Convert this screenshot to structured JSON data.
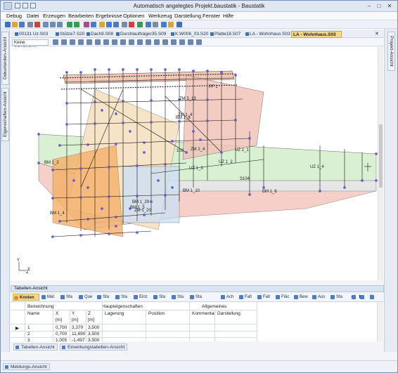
{
  "window": {
    "title": "Automatisch angelegtes Projekt.baustatik - Baustatik",
    "controls": {
      "minimize": "–",
      "maximize": "□",
      "close": "✕"
    }
  },
  "menu": [
    "Debug",
    "Datei",
    "Erzeugen",
    "Bearbeiten",
    "Ergebnisse",
    "Optionen",
    "Werkzeug",
    "Darstellung",
    "Fenster",
    "Hilfe"
  ],
  "side_panels": {
    "left_top": "Dokumenten-Ansicht",
    "left_bottom": "Eigenschaften-Ansicht",
    "right": "Projekt-Ansicht"
  },
  "document_tabs": [
    {
      "label": "00131 Uz.S03",
      "active": false
    },
    {
      "label": "Stütze7.S20",
      "active": false
    },
    {
      "label": "Dach9.S08",
      "active": false
    },
    {
      "label": "Durchlaufträger35.S09",
      "active": false
    },
    {
      "label": "K.W006_03.S20",
      "active": false
    },
    {
      "label": "Platte18.S07",
      "active": false
    },
    {
      "label": "LA - Wohnhaus.S03",
      "active": false
    },
    {
      "label": "LA - Wohnhaus.S03",
      "active": true
    }
  ],
  "view_toolbar": {
    "workplane_select": "Keine Arbeitseben ▾"
  },
  "model_labels": [
    "BM 1_2",
    "BM 1_3",
    "BM 1_4",
    "BM 1_5",
    "BM 1_6",
    "BM 1_10",
    "ZM 1_4",
    "ZM 1_20",
    "UZ 1_1",
    "UZ 1_2",
    "UZ 1_3",
    "UZ 1_4",
    "PF 1",
    "S104",
    "102",
    "ZM 2_4",
    "ZM 3_13",
    "BM 1_29"
  ],
  "axis_labels": {
    "x": "X",
    "y": "Y",
    "z": "Z"
  },
  "table_view": {
    "title": "Tabellen-Ansicht",
    "tools": [
      {
        "label": "Knoten",
        "active": true
      },
      {
        "label": "Mat",
        "active": false
      },
      {
        "label": "Sta",
        "active": false
      },
      {
        "label": "Que",
        "active": false
      },
      {
        "label": "Sta",
        "active": false
      },
      {
        "label": "Sta",
        "active": false
      },
      {
        "label": "Einz",
        "active": false
      },
      {
        "label": "Sta",
        "active": false
      },
      {
        "label": "Sta",
        "active": false
      },
      {
        "label": "Sta",
        "active": false
      },
      {
        "label": "Ach",
        "active": false
      },
      {
        "label": "Falt",
        "active": false
      },
      {
        "label": "Falt",
        "active": false
      },
      {
        "label": "Fläc",
        "active": false
      },
      {
        "label": "Bew",
        "active": false
      },
      {
        "label": "Aus",
        "active": false
      },
      {
        "label": "Sta",
        "active": false
      }
    ],
    "group_headers": {
      "bezeichnung": "Bezeichnung",
      "haupt": "Haupteigenschaften",
      "allgemein": "Allgemeines"
    },
    "columns": [
      "Name",
      "X",
      "Y",
      "Z",
      "Lagerung",
      "Position",
      "Kommentar",
      "Darstellung"
    ],
    "units": [
      "",
      "[m]",
      "[m]",
      "[m]",
      "",
      "",
      "",
      ""
    ],
    "rows": [
      {
        "name": "1",
        "x": "0,700",
        "y": "3,370",
        "z": "3,500"
      },
      {
        "name": "2",
        "x": "0,700",
        "y": "11,890",
        "z": "3,500"
      },
      {
        "name": "3",
        "x": "1,005",
        "y": "-1,497",
        "z": "3,500"
      }
    ],
    "bottom_tabs": [
      "Tabellen-Ansicht",
      "Einwirkungstabellen-Ansicht"
    ]
  },
  "status_tab": "Meldungs-Ansicht"
}
